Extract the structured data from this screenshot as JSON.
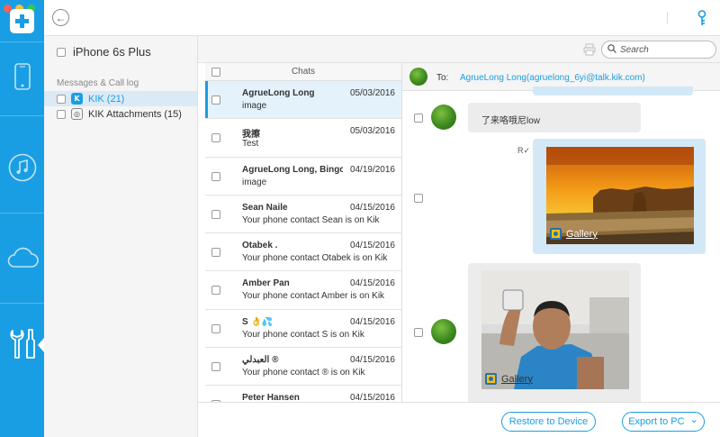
{
  "window": {
    "traffic_colors": [
      "#fc605b",
      "#fdbc40",
      "#34c84a"
    ]
  },
  "rail": {
    "accent": "#1a9ee3",
    "items": [
      {
        "icon": "phone-icon"
      },
      {
        "icon": "music-icon"
      },
      {
        "icon": "cloud-icon"
      },
      {
        "icon": "tools-icon",
        "active": true
      }
    ]
  },
  "device": {
    "name": "iPhone 6s Plus"
  },
  "tree": {
    "section_label": "Messages & Call log",
    "items": [
      {
        "label": "KIK (21)",
        "icon": "kik-icon",
        "selected": true
      },
      {
        "label": "KIK Attachments (15)",
        "icon": "attachment-icon",
        "selected": false
      }
    ]
  },
  "search": {
    "placeholder": "Search"
  },
  "chats": {
    "header": "Chats",
    "rows": [
      {
        "name": "AgrueLong Long",
        "date": "05/03/2016",
        "preview": "image"
      },
      {
        "name": "我擦",
        "date": "05/03/2016",
        "preview": "Test"
      },
      {
        "name": "AgrueLong Long, Bingo...",
        "date": "04/19/2016",
        "preview": "image"
      },
      {
        "name": "Sean Naile",
        "date": "04/15/2016",
        "preview": "Your phone contact Sean is on Kik"
      },
      {
        "name": "Otabek .",
        "date": "04/15/2016",
        "preview": "Your phone contact Otabek is on Kik"
      },
      {
        "name": "Amber Pan",
        "date": "04/15/2016",
        "preview": "Your phone contact Amber is on Kik"
      },
      {
        "name": "S 👌💦",
        "date": "04/15/2016",
        "preview": "Your phone contact S is on Kik"
      },
      {
        "name": "العبدلي ®",
        "date": "04/15/2016",
        "preview": "Your phone contact ® is on Kik"
      },
      {
        "name": "Peter Hansen",
        "date": "04/15/2016",
        "preview": ""
      }
    ]
  },
  "conversation": {
    "to_label": "To:",
    "to_value": "AgrueLong Long(agruelong_6yi@talk.kik.com)",
    "message_text": "了来咯哦尼low",
    "read_mark": "R✓",
    "gallery_label": "Gallery"
  },
  "actions": {
    "restore": "Restore to Device",
    "export": "Export to PC",
    "export_caret": "⌄"
  }
}
